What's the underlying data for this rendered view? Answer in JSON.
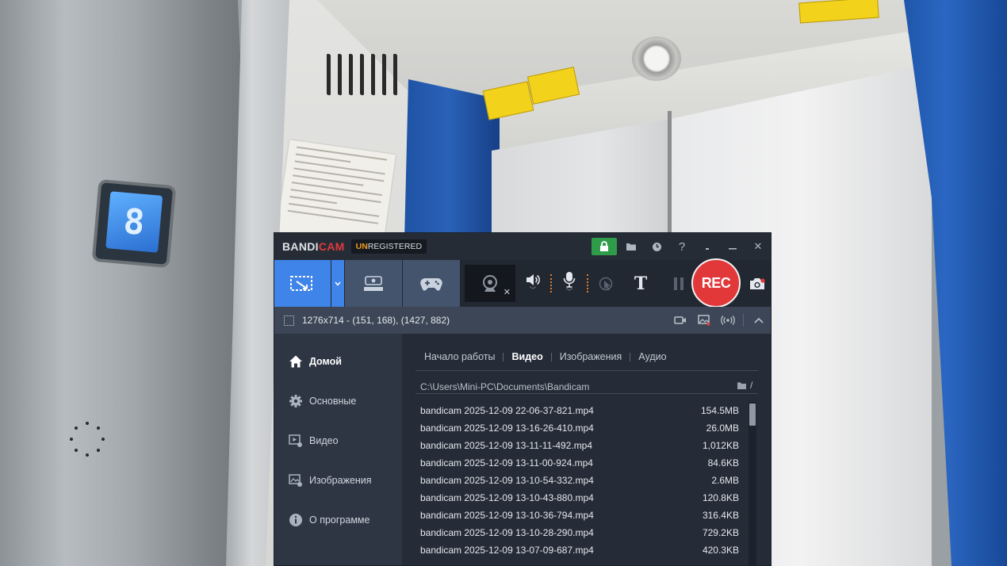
{
  "background": {
    "floor_display": "8"
  },
  "bandicam": {
    "brand_prefix": "BANDI",
    "brand_suffix": "CAM",
    "license_prefix": "UN",
    "license_suffix": "REGISTERED",
    "title_icons": [
      "lock-icon",
      "folder-icon",
      "clock-icon",
      "help-icon",
      "minimize-tray-icon",
      "minimize-icon",
      "close-icon"
    ],
    "help_glyph": "?",
    "close_glyph": "✕",
    "toolbar": {
      "modes": [
        "rectangle-area-icon",
        "hdmi-icon",
        "gamepad-icon"
      ],
      "tools": [
        "webcam-icon",
        "speaker-icon",
        "microphone-icon",
        "cursor-click-icon",
        "text-icon",
        "pause-icon"
      ],
      "text_glyph": "T",
      "rec_label": "REC"
    },
    "info": {
      "resolution_text": "1276x714 - (151, 168), (1427, 882)"
    },
    "sidebar": {
      "items": [
        {
          "label": "Домой",
          "icon": "home-icon"
        },
        {
          "label": "Основные",
          "icon": "gear-icon"
        },
        {
          "label": "Видео",
          "icon": "video-settings-icon"
        },
        {
          "label": "Изображения",
          "icon": "image-settings-icon"
        },
        {
          "label": "О программе",
          "icon": "info-icon"
        }
      ]
    },
    "tabs": [
      "Начало работы",
      "Видео",
      "Изображения",
      "Аудио"
    ],
    "active_tab": "Видео",
    "folder_path": "C:\\Users\\Mini-PC\\Documents\\Bandicam",
    "path_extra": "/",
    "files": [
      {
        "name": "bandicam 2025-12-09 22-06-37-821.mp4",
        "size": "154.5MB"
      },
      {
        "name": "bandicam 2025-12-09 13-16-26-410.mp4",
        "size": "26.0MB"
      },
      {
        "name": "bandicam 2025-12-09 13-11-11-492.mp4",
        "size": "1,012KB"
      },
      {
        "name": "bandicam 2025-12-09 13-11-00-924.mp4",
        "size": "84.6KB"
      },
      {
        "name": "bandicam 2025-12-09 13-10-54-332.mp4",
        "size": "2.6MB"
      },
      {
        "name": "bandicam 2025-12-09 13-10-43-880.mp4",
        "size": "120.8KB"
      },
      {
        "name": "bandicam 2025-12-09 13-10-36-794.mp4",
        "size": "316.4KB"
      },
      {
        "name": "bandicam 2025-12-09 13-10-28-290.mp4",
        "size": "729.2KB"
      },
      {
        "name": "bandicam 2025-12-09 13-07-09-687.mp4",
        "size": "420.3KB"
      }
    ],
    "colors": {
      "accent_blue": "#3f84e8",
      "rec_red": "#e2383a",
      "lock_green": "#2f9c4a",
      "unregistered_orange": "#f19a1e"
    }
  }
}
